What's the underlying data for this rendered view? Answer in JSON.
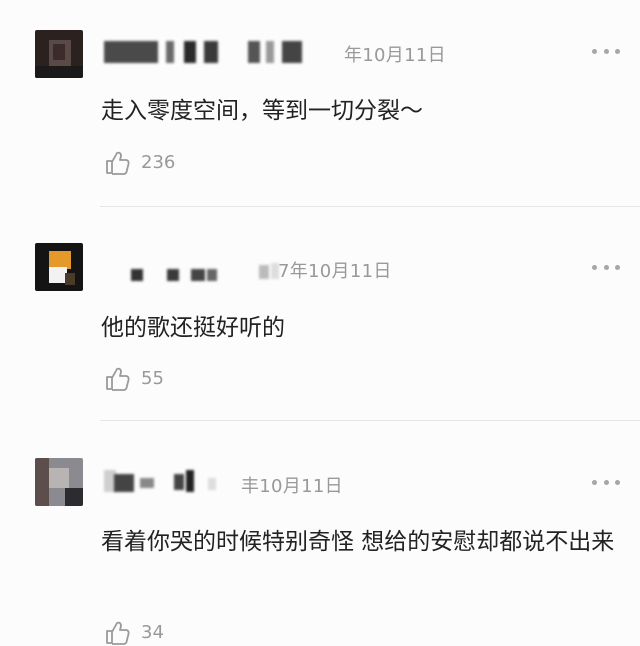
{
  "comments": [
    {
      "date": "年10月11日",
      "text": "走入零度空间，等到一切分裂～",
      "likes": "236",
      "avatar_colors": [
        "#222222",
        "#5a4a45",
        "#3b2b2a",
        "#1a1a1a"
      ]
    },
    {
      "date": "7年10月11日",
      "text": "他的歌还挺好听的",
      "likes": "55",
      "avatar_colors": [
        "#141414",
        "#e39a2b",
        "#f2f2f2",
        "#4a3a2a"
      ]
    },
    {
      "date": "丰10月11日",
      "text": "看着你哭的时候特别奇怪 想给的安慰却都说不出来",
      "likes": "34",
      "avatar_colors": [
        "#8a8a90",
        "#5c4e4a",
        "#b9b4b4",
        "#2c2c30"
      ]
    }
  ],
  "icons": {
    "like": "thumbs-up-icon",
    "more": "more-dots-icon"
  }
}
